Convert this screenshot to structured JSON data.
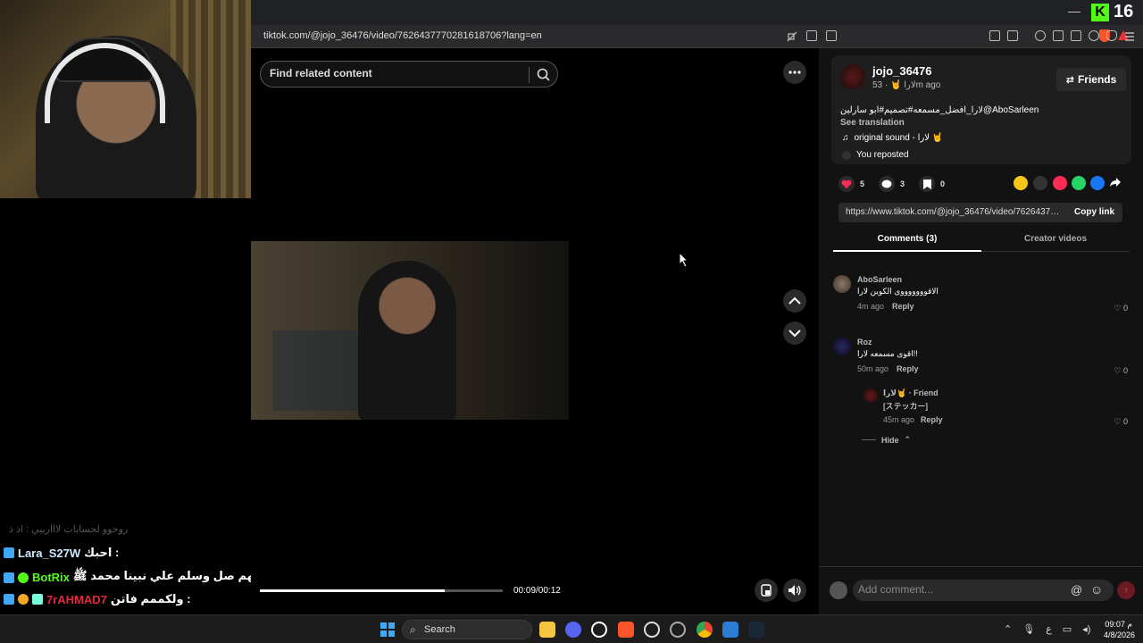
{
  "browser": {
    "url": "tiktok.com/@jojo_36476/video/7626437770281618706?lang=en"
  },
  "overlay": {
    "kick_count": "16",
    "chat": [
      {
        "user": "",
        "text": "روحوو لحسابات لاااريبي : اذ ذ",
        "faded": true,
        "color": "#555"
      },
      {
        "user": "Lara_S27W",
        "text": "احبك :",
        "faded": false,
        "color": "#cfe8ff"
      },
      {
        "user": "BotRix",
        "text": "اللهم صل وسلم علي نبينا محمد ﷺ :",
        "faded": false,
        "color": "#53fc18"
      },
      {
        "user": "7rAHMAD7",
        "text": "ولكممم فاتن :",
        "faded": false,
        "color": "#e8263a"
      }
    ]
  },
  "video": {
    "search_placeholder": "Find related content",
    "time": "00:09/00:12",
    "progress": 0.76
  },
  "post": {
    "author": "jojo_36476",
    "meta": "لارا 🤘 · 53m ago",
    "friends_label": "Friends",
    "description": "لارا_افضل_مسمعه#تصميم#ابو سارلين@AboSarleen",
    "see_translation": "See translation",
    "sound": "original sound - لارا 🤘",
    "reposted": "You reposted",
    "likes": "5",
    "comments": "3",
    "saves": "0",
    "link": "https://www.tiktok.com/@jojo_36476/video/762643777...",
    "copy_link": "Copy link"
  },
  "tabs": {
    "comments": "Comments (3)",
    "creator_videos": "Creator videos"
  },
  "comments": [
    {
      "user": "AboSarleen",
      "text": "الاقوووووووى الكوين لارا",
      "time": "4m ago",
      "reply": "Reply",
      "likes": "0"
    },
    {
      "user": "Roz",
      "text": "اقوى مسمعه لارا!!",
      "time": "50m ago",
      "reply": "Reply",
      "likes": "0"
    },
    {
      "user": "لارا🤘 · Friend",
      "text": "[ステッカー]",
      "time": "45m ago",
      "reply": "Reply",
      "likes": "0"
    }
  ],
  "hide_label": "Hide",
  "comment_placeholder": "Add comment...",
  "taskbar": {
    "search": "Search",
    "lang": "ع",
    "time": "09:07 م",
    "date": "4/8/2026"
  },
  "colors": {
    "kick_green": "#53fc18",
    "tiktok_red": "#fe2c55",
    "accent_blue": "#3fa9f5"
  }
}
